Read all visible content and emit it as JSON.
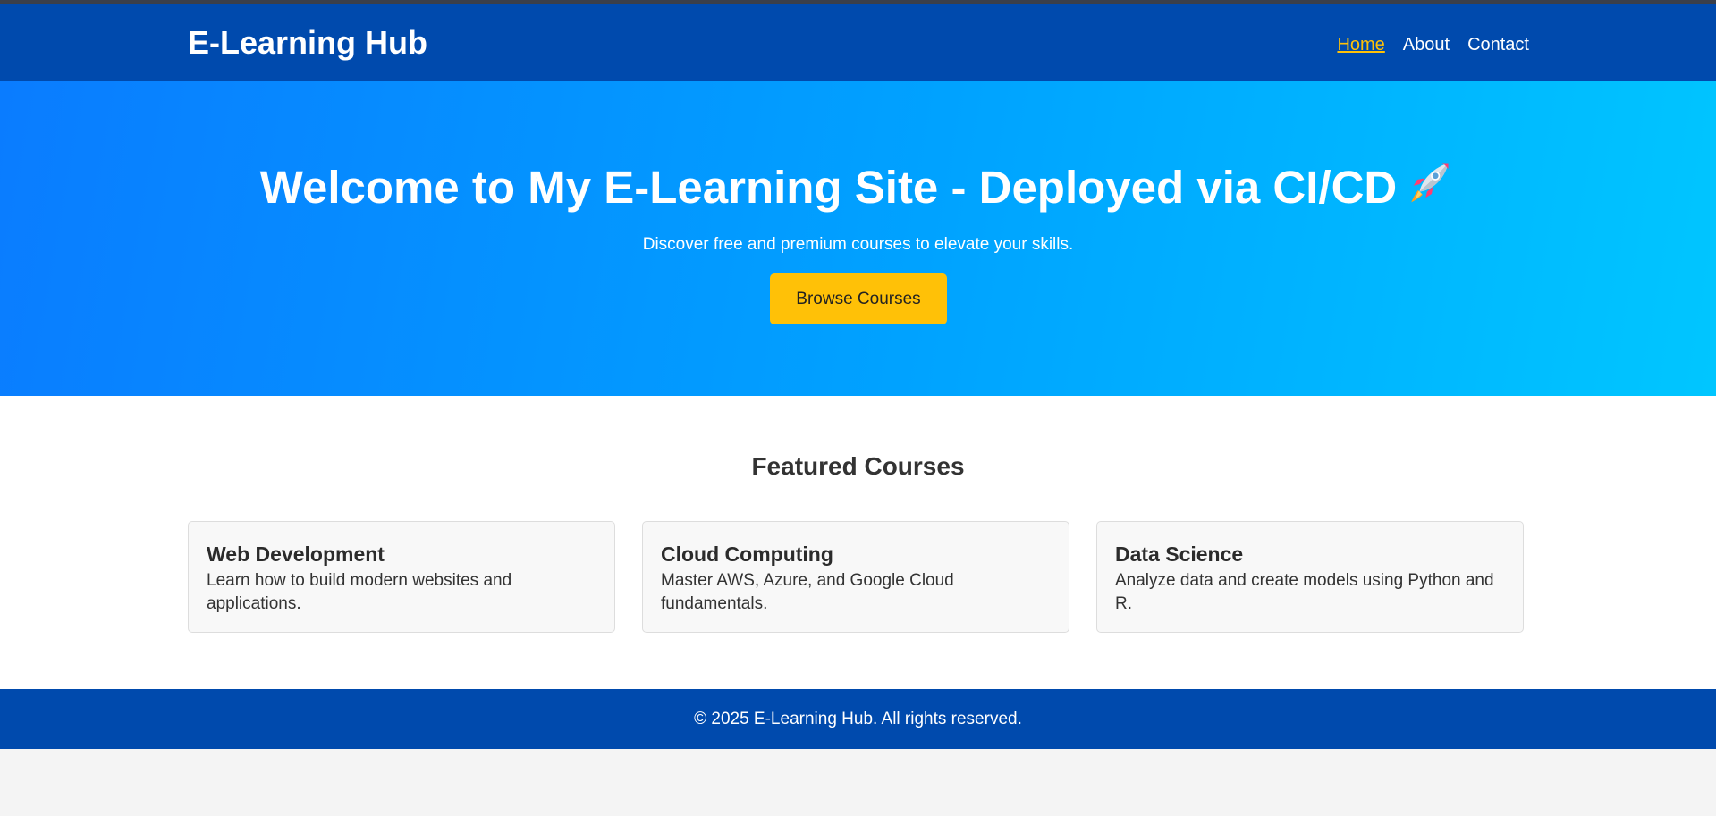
{
  "brand": "E-Learning Hub",
  "nav": {
    "items": [
      {
        "label": "Home",
        "active": true
      },
      {
        "label": "About",
        "active": false
      },
      {
        "label": "Contact",
        "active": false
      }
    ]
  },
  "hero": {
    "title": "Welcome to My E-Learning Site - Deployed via CI/CD",
    "icon": "rocket-icon",
    "subtitle": "Discover free and premium courses to elevate your skills.",
    "button_label": "Browse Courses"
  },
  "featured": {
    "title": "Featured Courses",
    "courses": [
      {
        "title": "Web Development",
        "description": "Learn how to build modern websites and applications."
      },
      {
        "title": "Cloud Computing",
        "description": "Master AWS, Azure, and Google Cloud fundamentals."
      },
      {
        "title": "Data Science",
        "description": "Analyze data and create models using Python and R."
      }
    ]
  },
  "footer": {
    "text": "© 2025 E-Learning Hub. All rights reserved."
  },
  "colors": {
    "navbar": "#004aad",
    "hero_gradient_start": "#0a7cff",
    "hero_gradient_end": "#00c6ff",
    "accent": "#ffc107",
    "footer": "#004aad"
  }
}
